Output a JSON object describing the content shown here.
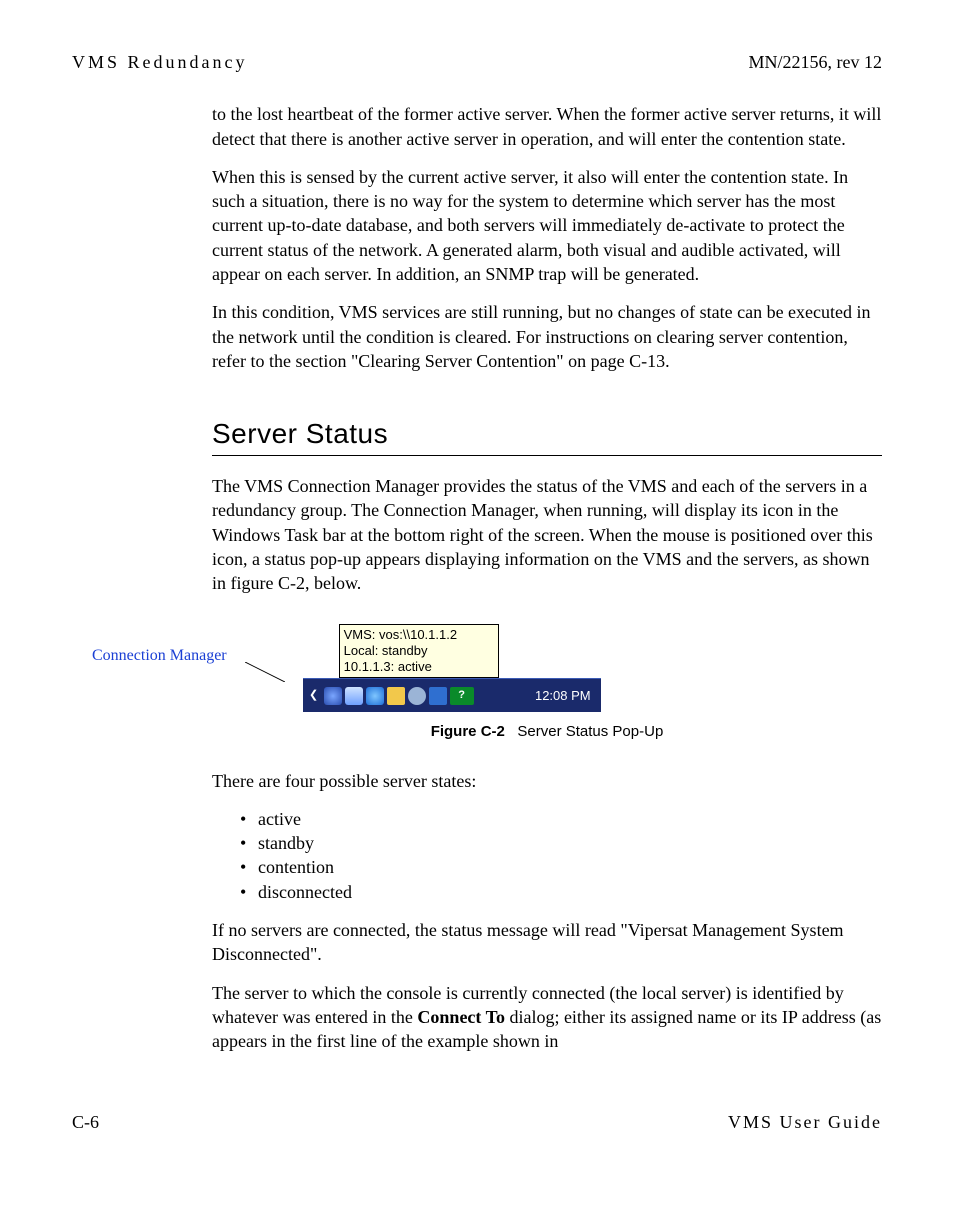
{
  "header": {
    "left": "VMS Redundancy",
    "right": "MN/22156, rev 12"
  },
  "paragraphs": {
    "p1": "to the lost heartbeat of the former active server. When the former active server returns, it will detect that there is another active server in operation, and will enter the contention state.",
    "p2": "When this is sensed by the current active server, it also will enter the contention state. In such a situation, there is no way for the system to determine which server has the most current up-to-date database, and both servers will immediately de-activate to protect the current status of the network. A generated alarm, both visual and audible activated, will appear on each server. In addition, an SNMP trap will be generated.",
    "p3": "In this condition, VMS services are still running, but no changes of state can be executed in the network until the condition is cleared. For instructions on clearing server contention, refer to the section \"Clearing Server Contention\" on page C-13."
  },
  "section_title": "Server Status",
  "section_intro": "The VMS Connection Manager provides the status of the VMS and each of the servers in a redundancy group. The Connection Manager, when running, will display its icon in the Windows Task bar at the bottom right of the screen. When the mouse is positioned over this icon, a status pop-up appears displaying information on the VMS and the servers, as shown in figure C-2, below.",
  "figure": {
    "callout_label": "Connection Manager",
    "tooltip": {
      "line1": "VMS: vos:\\\\10.1.1.2",
      "line2": "Local: standby",
      "line3": "10.1.1.3: active"
    },
    "tray": {
      "help_badge": "?",
      "clock": "12:08 PM"
    },
    "caption_label": "Figure C-2",
    "caption_text": "Server Status Pop-Up"
  },
  "states_intro": "There are four possible server states:",
  "states": [
    "active",
    "standby",
    "contention",
    "disconnected"
  ],
  "after_states_1": "If no servers are connected, the status message will read \"Vipersat Management System Disconnected\".",
  "after_states_2a": "The server to which the console is currently connected (the local server) is identified by whatever was entered in the ",
  "after_states_2_bold": "Connect To",
  "after_states_2b": " dialog; either its assigned name or its IP address (as appears in the first line of the example shown in",
  "footer": {
    "left": "C-6",
    "right": "VMS User Guide"
  }
}
